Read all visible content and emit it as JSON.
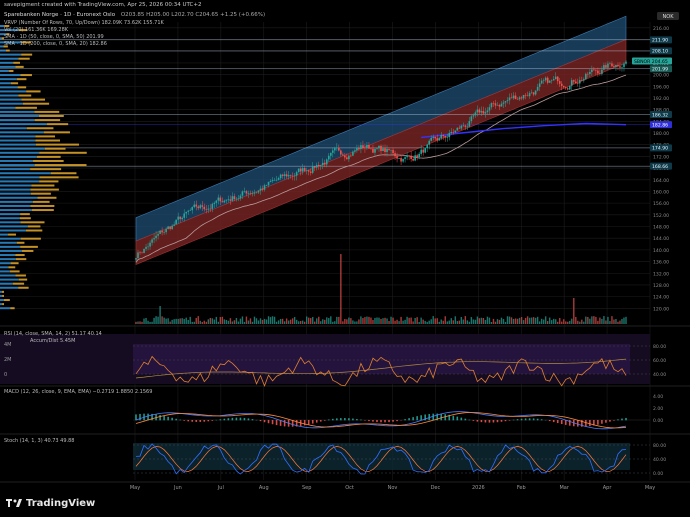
{
  "header": {
    "created_by": "savepigment created with TradingView.com, Apr 25, 2026 00:34 UTC+2"
  },
  "legends": {
    "main_title": "Sparebanken Norge · 1D · Euronext Oslo",
    "ohlc": "O203.85 H205.00 L202.70 C204.65 +1.25 (+0.66%)",
    "vrvp": "VRVP (Number Of Rows, 70, Up/Down) 182.09K 73.62K 155.71K",
    "vol": "Vol (20) 161.36K 169.28K",
    "sma50": "SMA · 1D (50, close, 0, SMA, 50) 201.99",
    "sma200": "SMA · 1D (200, close, 0, SMA, 20) 182.86",
    "rsi": "RSI (14, close, SMA, 14, 2) 51.17 40.14",
    "accum": "Accum/Dist 5.45M",
    "macd": "MACD (12, 26, close, 9, EMA, EMA) −0.2719 1.8850 2.1569",
    "stoch": "Stoch (14, 1, 3) 40.73 49.88"
  },
  "currency": "NOK",
  "colors": {
    "background": "#000000",
    "grid": "#1c1c1c",
    "up": "#26a69a",
    "down": "#ef5350",
    "channel_upper_fill": "#1f4e74",
    "channel_lower_fill": "#7a2424",
    "sma50": "#b89a9a",
    "sma200": "#3333ff",
    "vrvp_up": "#2f8fd6",
    "vrvp_down": "#d9a12a",
    "rsi_line": "#e08030",
    "rsi_ma": "#f0c040",
    "macd_line": "#4f7fff",
    "signal_line": "#ff8c3a",
    "stoch_k": "#2f6fff",
    "stoch_d": "#ff7a3a"
  },
  "chart_data": {
    "type": "candlestick",
    "x_axis_labels": [
      "May",
      "Jun",
      "Jul",
      "Aug",
      "Sep",
      "Oct",
      "Nov",
      "Dec",
      "2026",
      "Feb",
      "Mar",
      "Apr",
      "May"
    ],
    "y_axis_ticks": [
      120,
      124,
      128,
      132,
      136,
      140,
      144,
      148,
      152,
      156,
      160,
      164,
      168,
      172,
      176,
      180,
      184,
      188,
      192,
      196,
      200,
      204,
      208,
      212,
      216
    ],
    "price_tags": [
      {
        "label": "211.90",
        "value": 211.9
      },
      {
        "label": "208.10",
        "value": 208.1
      },
      {
        "label": "SBNOR 204.65",
        "value": 204.65
      },
      {
        "label": "201.99",
        "value": 201.99
      },
      {
        "label": "186.32",
        "value": 186.32
      },
      {
        "label": "182.86",
        "value": 182.86
      },
      {
        "label": "174.90",
        "value": 174.9
      },
      {
        "label": "168.66",
        "value": 168.66
      }
    ],
    "ylim": [
      116,
      218
    ],
    "approx_price_path": {
      "months": [
        "May",
        "Jun",
        "Jul",
        "Aug",
        "Sep",
        "Oct",
        "Nov",
        "Dec",
        "Jan",
        "Feb",
        "Mar",
        "Apr"
      ],
      "close": [
        140,
        152,
        158,
        163,
        170,
        176,
        171,
        180,
        190,
        196,
        200,
        206
      ]
    },
    "sma200_approx": {
      "months": [
        "Nov",
        "Dec",
        "Jan",
        "Feb",
        "Mar",
        "Apr"
      ],
      "values": [
        178.5,
        180.0,
        181.5,
        182.5,
        183.3,
        182.86
      ]
    },
    "volume_scale_labels": [
      "4M",
      "2M",
      "0"
    ],
    "rsi": {
      "ticks": [
        80,
        60,
        40
      ],
      "last": 51.17,
      "ma_last": 40.14
    },
    "macd": {
      "ticks": [
        4.0,
        2.0,
        0.0
      ],
      "macd": -0.2719,
      "signal": 1.885,
      "hist": 2.1569
    },
    "stoch": {
      "ticks": [
        80,
        40,
        0
      ],
      "k": 40.73,
      "d": 49.88
    }
  },
  "footer": {
    "brand": "TradingView"
  }
}
